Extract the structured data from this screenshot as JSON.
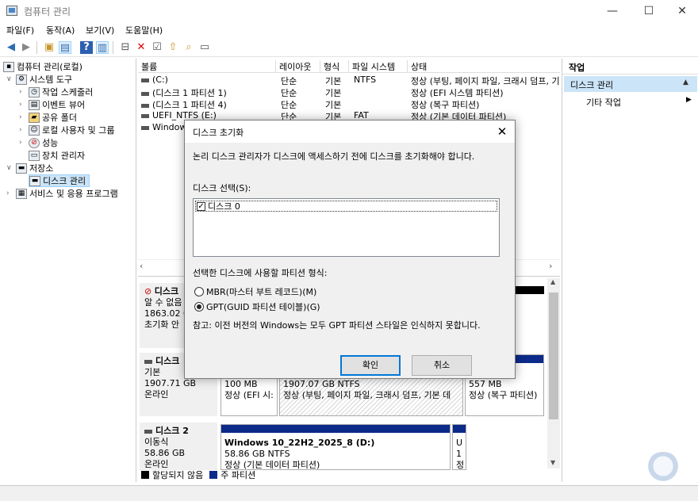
{
  "window": {
    "title": "컴퓨터 관리",
    "controls": {
      "minimize": "—",
      "maximize": "☐",
      "close": "✕"
    }
  },
  "menu": [
    "파일(F)",
    "동작(A)",
    "보기(V)",
    "도움말(H)"
  ],
  "toolbar": [
    "back-icon",
    "forward-icon",
    "up-folder-icon",
    "show-hide-tree-icon",
    "help-icon",
    "show-actions-icon",
    "connect-icon",
    "delete-icon",
    "properties-icon",
    "export-icon",
    "find-icon",
    "list-icon"
  ],
  "tree": {
    "root": "컴퓨터 관리(로컬)",
    "system_tools": "시스템 도구",
    "task_scheduler": "작업 스케줄러",
    "event_viewer": "이벤트 뷰어",
    "shared_folders": "공유 폴더",
    "local_users": "로컬 사용자 및 그룹",
    "performance": "성능",
    "device_manager": "장치 관리자",
    "storage": "저장소",
    "disk_management": "디스크 관리",
    "services": "서비스 및 응용 프로그램"
  },
  "volumes": {
    "headers": [
      "볼륨",
      "레이아웃",
      "형식",
      "파일 시스템",
      "상태"
    ],
    "rows": [
      [
        "(C:)",
        "단순",
        "기본",
        "NTFS",
        "정상 (부팅, 페이지 파일, 크래시 덤프, 기"
      ],
      [
        "(디스크 1 파티션 1)",
        "단순",
        "기본",
        "",
        "정상 (EFI 시스템 파티션)"
      ],
      [
        "(디스크 1 파티션 4)",
        "단순",
        "기본",
        "",
        "정상 (복구 파티션)"
      ],
      [
        "UEFI_NTFS (E:)",
        "단순",
        "기본",
        "FAT",
        "정상 (기본 데이터 파티션)"
      ],
      [
        "Windows",
        "",
        "",
        "",
        ""
      ]
    ]
  },
  "disks": {
    "disk_top": {
      "name": "디스크",
      "line1": "알 수 없음",
      "line2": "1863.02 G",
      "line3": "초기화 안"
    },
    "disk1": {
      "name": "디스크",
      "type": "기본",
      "size": "1907.71 GB",
      "state": "온라인",
      "partitions": [
        {
          "size": "100 MB",
          "status": "정상 (EFI 시:"
        },
        {
          "size": "1907.07 GB NTFS",
          "status": "정상 (부팅, 페이지 파일, 크래시 덤프, 기본 데"
        },
        {
          "size": "557 MB",
          "status": "정상 (복구 파티션)"
        }
      ]
    },
    "disk2": {
      "name": "디스크 2",
      "type": "이동식",
      "size": "58.86 GB",
      "state": "온라인",
      "partition": {
        "name": "Windows 10_22H2_2025_8  (D:)",
        "size": "58.86 GB NTFS",
        "status": "정상 (기본 데이터 파티션)"
      },
      "small": [
        "U",
        "1",
        "정"
      ]
    }
  },
  "legend": {
    "unallocated": "할당되지 않음",
    "primary": "주 파티션"
  },
  "actions": {
    "title": "작업",
    "section": "디스크 관리",
    "other": "기타 작업"
  },
  "dialog": {
    "title": "디스크 초기화",
    "intro": "논리 디스크 관리자가 디스크에 액세스하기 전에 디스크를 초기화해야 합니다.",
    "select_label": "디스크 선택(S):",
    "disk_item": "디스크 0",
    "style_label": "선택한 디스크에 사용할 파티션 형식:",
    "mbr_label": "MBR(마스터 부트 레코드)(M)",
    "gpt_label": "GPT(GUID 파티션 테이블)(G)",
    "note": "참고: 이전 버전의 Windows는 모두 GPT 파티션 스타일은 인식하지 못합니다.",
    "ok": "확인",
    "cancel": "취소",
    "close": "✕",
    "disk_checked": true,
    "gpt_selected": true
  },
  "colors": {
    "primary_partition": "#0b2a8a",
    "selection": "#cce4f7",
    "ok_border": "#0078d7"
  }
}
